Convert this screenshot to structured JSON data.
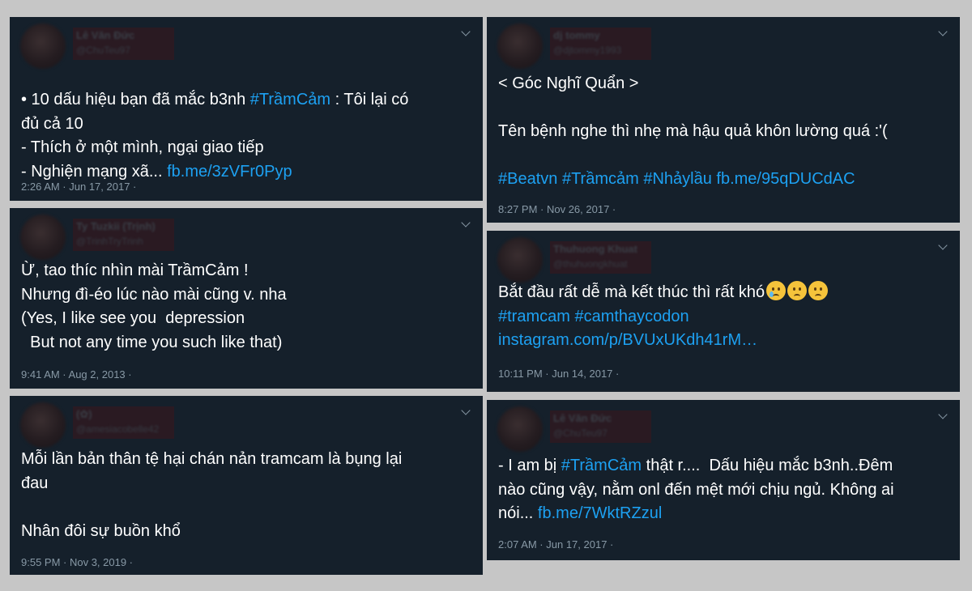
{
  "tweets": [
    {
      "name": "Lê Văn Đức",
      "handle": "@ChuTeu97",
      "lines": [
        [
          {
            "t": "• 10 dấu hiệu bạn đã mắc b3nh "
          },
          {
            "t": "#TrầmCảm",
            "link": true
          },
          {
            "t": " : Tôi lại có"
          }
        ],
        [
          {
            "t": "đủ cả 10"
          }
        ],
        [
          {
            "t": "- Thích ở một mình, ngại giao tiếp"
          }
        ],
        [
          {
            "t": "- Nghiện mạng xã... "
          },
          {
            "t": "fb.me/3zVFr0Pyp",
            "link": true
          }
        ]
      ],
      "meta": "2:26 AM · Jun 17, 2017 ·"
    },
    {
      "name": "Ty Tuzkii (Trịnh)",
      "handle": "@TrinhTryTrinh",
      "lines": [
        [
          {
            "t": "Ừ, tao thíc nhìn mài TrầmCảm !"
          }
        ],
        [
          {
            "t": "Nhưng đì-éo lúc nào mài cũng v. nha"
          }
        ],
        [
          {
            "t": "(Yes, I like see you  depression"
          }
        ],
        [
          {
            "t": "  But not any time you such like that)"
          }
        ]
      ],
      "meta": "9:41 AM · Aug 2, 2013 ·"
    },
    {
      "name": "(✿)",
      "handle": "@amesiacobelle42",
      "lines": [
        [
          {
            "t": "Mỗi lần bản thân tệ hại chán nản tramcam là bụng lại"
          }
        ],
        [
          {
            "t": "đau"
          }
        ],
        [
          {
            "t": ""
          }
        ],
        [
          {
            "t": "Nhân đôi sự buồn khổ"
          }
        ]
      ],
      "meta": "9:55 PM · Nov 3, 2019 ·"
    },
    {
      "name": "dj tommy",
      "handle": "@djtommy1993",
      "lines": [
        [
          {
            "t": "< Góc Nghĩ Quẩn >"
          }
        ],
        [
          {
            "t": ""
          }
        ],
        [
          {
            "t": "Tên bệnh nghe thì nhẹ mà hậu quả khôn lường quá :'("
          }
        ],
        [
          {
            "t": ""
          }
        ],
        [
          {
            "t": "#Beatvn #Trầmcảm #Nhảylầu fb.me/95qDUCdAC",
            "link": true
          }
        ]
      ],
      "meta": "8:27 PM · Nov 26, 2017 ·"
    },
    {
      "name": "Thuhuong Khuat",
      "handle": "@thuhuongkhuat",
      "lines": [
        [
          {
            "t": "Bắt đầu rất dễ mà kết thúc thì rất khó"
          },
          {
            "emoji": "crying-face"
          },
          {
            "emoji": "sad-face"
          },
          {
            "emoji": "sad-face"
          }
        ],
        [
          {
            "t": "#tramcam #camthaycodon",
            "link": true
          }
        ],
        [
          {
            "t": "instagram.com/p/BVUxUKdh41rM…",
            "link": true
          }
        ]
      ],
      "meta": "10:11 PM · Jun 14, 2017 ·"
    },
    {
      "name": "Lê Văn Đức",
      "handle": "@ChuTeu97",
      "lines": [
        [
          {
            "t": "- I am bị "
          },
          {
            "t": "#TrầmCảm",
            "link": true
          },
          {
            "t": " thật r....  Dấu hiệu mắc b3nh..Đêm"
          }
        ],
        [
          {
            "t": "nào cũng vậy, nằm onl đến mệt mới chịu ngủ. Không ai"
          }
        ],
        [
          {
            "t": "nói... "
          },
          {
            "t": "fb.me/7WktRZzul",
            "link": true
          }
        ]
      ],
      "meta": "2:07 AM · Jun 17, 2017 ·"
    }
  ],
  "colors": {
    "background": "#c6c6c6",
    "card": "#15202b",
    "text": "#ffffff",
    "link": "#1da1f2",
    "muted": "#8899a6"
  },
  "icons": [
    "chevron-down-icon",
    "avatar"
  ]
}
